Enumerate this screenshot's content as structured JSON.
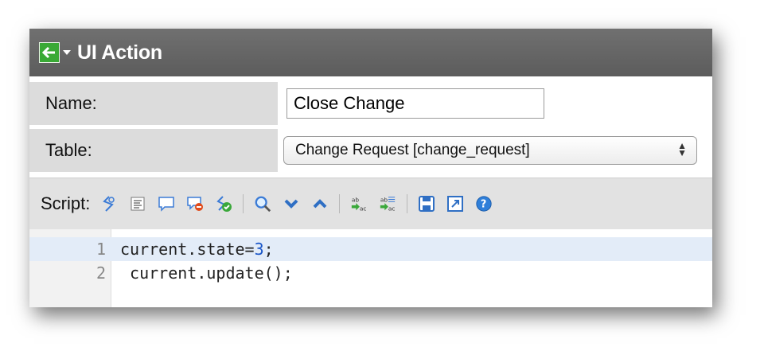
{
  "window": {
    "title": "UI Action"
  },
  "form": {
    "name_label": "Name:",
    "name_value": "Close Change",
    "table_label": "Table:",
    "table_value": "Change Request [change_request]"
  },
  "toolbar": {
    "script_label": "Script:",
    "icons": [
      "toggle-syntax-icon",
      "format-code-icon",
      "comment-icon",
      "remove-comment-icon",
      "check-syntax-icon",
      "search-icon",
      "next-icon",
      "previous-icon",
      "replace-icon",
      "replace-all-icon",
      "save-icon",
      "fullscreen-icon",
      "help-icon"
    ]
  },
  "editor": {
    "lines": [
      {
        "number": "1",
        "code_prefix": "current.state=",
        "code_num": "3",
        "code_suffix": ";"
      },
      {
        "number": "2",
        "code": " current.update();"
      }
    ]
  },
  "colors": {
    "titlebar": "#5f5f5f",
    "label_bg": "#dcdcdc",
    "active_line": "#e3ecf8",
    "back_icon": "#39a935"
  }
}
